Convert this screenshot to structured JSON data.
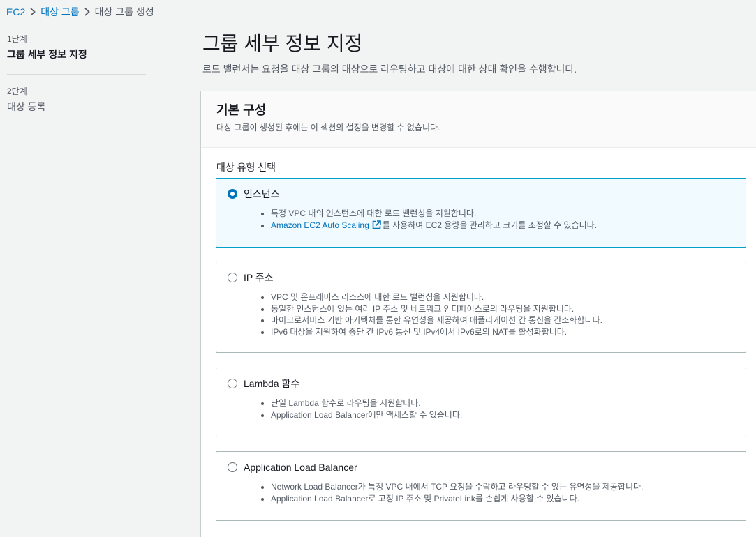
{
  "breadcrumb": {
    "items": [
      "EC2",
      "대상 그룹",
      "대상 그룹 생성"
    ]
  },
  "wizard": {
    "steps": [
      {
        "num": "1단계",
        "label": "그룹 세부 정보 지정"
      },
      {
        "num": "2단계",
        "label": "대상 등록"
      }
    ]
  },
  "page": {
    "title": "그룹 세부 정보 지정",
    "description": "로드 밸런서는 요청을 대상 그룹의 대상으로 라우팅하고 대상에 대한 상태 확인을 수행합니다."
  },
  "basic_config": {
    "title": "기본 구성",
    "description": "대상 그룹이 생성된 후에는 이 섹션의 설정을 변경할 수 없습니다.",
    "target_type_label": "대상 유형 선택"
  },
  "options": [
    {
      "label": "인스턴스",
      "selected": true,
      "bullets": [
        "특정 VPC 내의 인스턴스에 대한 로드 밸런싱을 지원합니다.",
        "를 사용하여 EC2 용량을 관리하고 크기를 조정할 수 있습니다."
      ],
      "link_text": "Amazon EC2 Auto Scaling"
    },
    {
      "label": "IP 주소",
      "selected": false,
      "bullets": [
        "VPC 및 온프레미스 리소스에 대한 로드 밸런싱을 지원합니다.",
        "동일한 인스턴스에 있는 여러 IP 주소 및 네트워크 인터페이스로의 라우팅을 지원합니다.",
        "마이크로서비스 기반 아키텍처를 통한 유연성을 제공하여 애플리케이션 간 통신을 간소화합니다.",
        "IPv6 대상을 지원하여 종단 간 IPv6 통신 및 IPv4에서 IPv6로의 NAT를 활성화합니다."
      ]
    },
    {
      "label": "Lambda 함수",
      "selected": false,
      "bullets": [
        "단일 Lambda 함수로 라우팅을 지원합니다.",
        "Application Load Balancer에만 액세스할 수 있습니다."
      ]
    },
    {
      "label": "Application Load Balancer",
      "selected": false,
      "bullets": [
        "Network Load Balancer가 특정 VPC 내에서 TCP 요청을 수락하고 라우팅할 수 있는 유연성을 제공합니다.",
        "Application Load Balancer로 고정 IP 주소 및 PrivateLink를 손쉽게 사용할 수 있습니다."
      ]
    }
  ],
  "colors": {
    "link": "#0073bb",
    "selected_border": "#00a1c9",
    "selected_bg": "#f1faff"
  }
}
